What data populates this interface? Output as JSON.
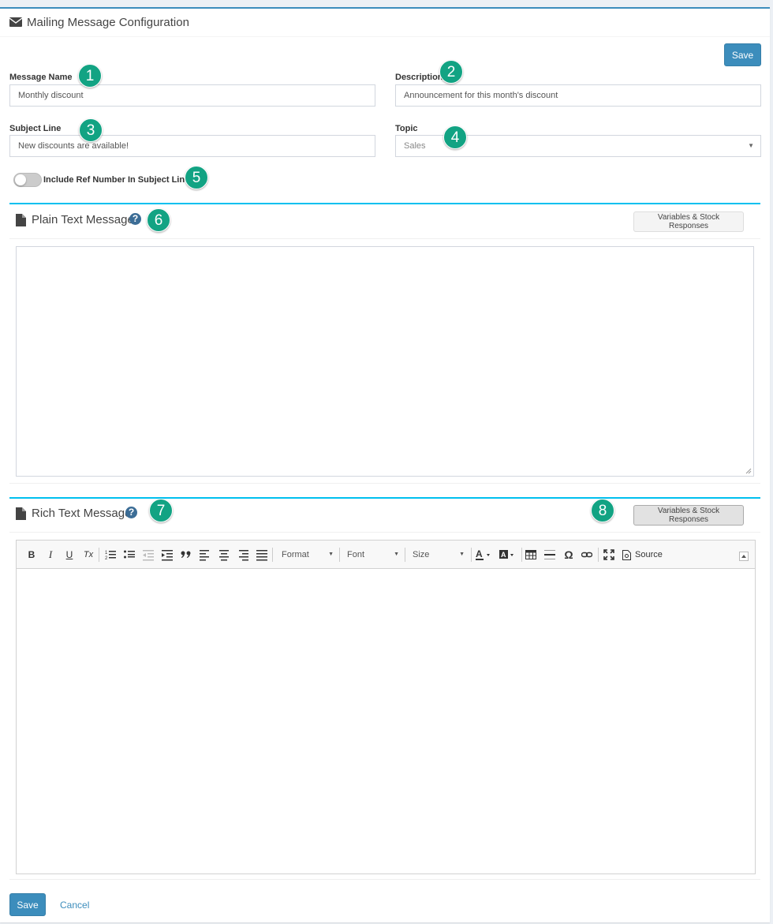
{
  "header": {
    "title": "Mailing Message Configuration",
    "icon": "envelope-icon"
  },
  "toolbar": {
    "save_label": "Save"
  },
  "form": {
    "message_name": {
      "label": "Message Name",
      "value": "Monthly discount"
    },
    "description": {
      "label": "Description",
      "value": "Announcement for this month's discount"
    },
    "subject_line": {
      "label": "Subject Line",
      "value": "New discounts are available!"
    },
    "topic": {
      "label": "Topic",
      "value": "Sales"
    },
    "include_ref": {
      "label": "Include Ref Number In Subject Line",
      "checked": false
    }
  },
  "plain_text": {
    "title": "Plain Text Message",
    "help": "?",
    "variables_label": "Variables & Stock Responses",
    "value": ""
  },
  "rich_text": {
    "title": "Rich Text Message",
    "help": "?",
    "variables_label": "Variables & Stock Responses",
    "toolbar": {
      "bold": "B",
      "italic": "I",
      "underline": "U",
      "remove_format": "Tx",
      "format": "Format",
      "font": "Font",
      "size": "Size",
      "special_char": "Ω",
      "source": "Source"
    }
  },
  "callouts": [
    "1",
    "2",
    "3",
    "4",
    "5",
    "6",
    "7",
    "8"
  ],
  "footer": {
    "save_label": "Save",
    "cancel_label": "Cancel"
  },
  "colors": {
    "primary": "#3c8dbc",
    "section_accent": "#00c0ef",
    "callout": "#12a383"
  }
}
